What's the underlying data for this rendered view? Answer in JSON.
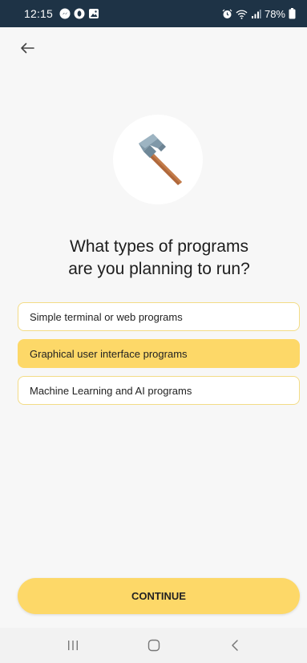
{
  "status_bar": {
    "time": "12:15",
    "battery": "78%",
    "icons": [
      "messenger-icon",
      "opera-icon",
      "gallery-icon",
      "alarm-icon",
      "wifi-icon",
      "signal-icon",
      "battery-icon"
    ]
  },
  "back_icon": "arrow-left-icon",
  "illustration_icon": "hammer-icon",
  "question": "What types of programs\nare you planning to run?",
  "options": [
    {
      "label": "Simple terminal or web programs",
      "selected": false
    },
    {
      "label": "Graphical user interface programs",
      "selected": true
    },
    {
      "label": "Machine Learning and AI programs",
      "selected": false
    }
  ],
  "continue_label": "CONTINUE",
  "nav_bar": {
    "icons": [
      "recent-apps-icon",
      "home-icon",
      "back-nav-icon"
    ]
  },
  "colors": {
    "accent": "#fdd868",
    "status_bar": "#1e3346",
    "option_border": "#f3dc86",
    "background": "#f7f7f7"
  }
}
